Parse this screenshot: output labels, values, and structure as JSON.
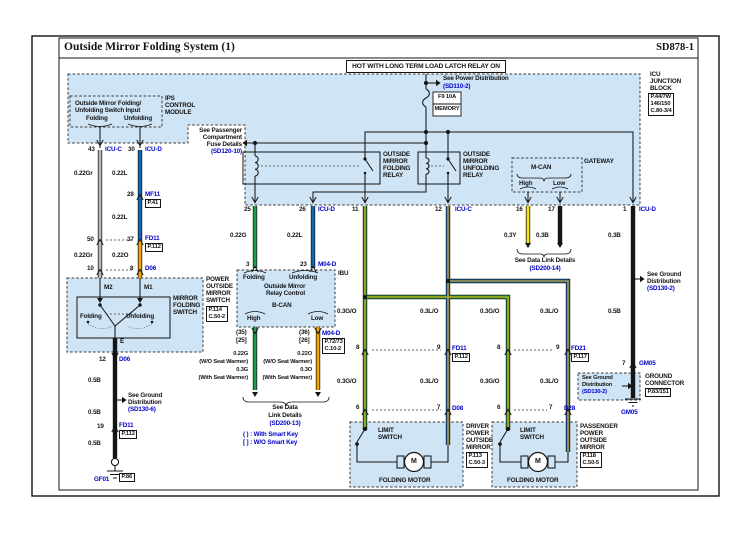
{
  "header": {
    "title": "Outside Mirror Folding System (1)",
    "code": "SD878-1"
  },
  "banner": "HOT WITH LONG TERM LOAD LATCH RELAY ON",
  "top": {
    "see_power": "See Power Distribution",
    "see_power_ref": "(SD110-2)",
    "fuse_name": "F9 10A",
    "fuse_use": "MEMORY",
    "pass1": "See Passenger",
    "pass2": "Compartment",
    "pass3": "Fuse Details",
    "pass_ref": "(SD120-10)"
  },
  "icu": {
    "n1": "ICU",
    "n2": "JUNCTION",
    "n3": "BLOCK",
    "r1": "P.44/7W",
    "r2": "146/150",
    "r3": "C.80-3/4"
  },
  "ips": {
    "n1": "IPS",
    "n2": "CONTROL",
    "n3": "MODULE",
    "t1": "Outside Mirror Folding/",
    "t2": "Unfolding Switch Input",
    "fold": "Folding",
    "unfold": "Unfolding"
  },
  "relays": {
    "f1": "OUTSIDE",
    "f2": "MIRROR",
    "f3": "FOLDING",
    "f4": "RELAY",
    "u3": "UNFOLDING"
  },
  "gateway": {
    "name": "GATEWAY",
    "bus": "M-CAN",
    "high": "High",
    "low": "Low"
  },
  "pins": {
    "p43": "43",
    "p30": "30",
    "p28": "28",
    "p50": "50",
    "p37": "37",
    "p10": "10",
    "p8": "8",
    "p12": "12",
    "p19": "19",
    "p25": "25",
    "p26": "26",
    "p11": "11",
    "p16": "16",
    "p17": "17",
    "p1": "1",
    "p3": "3",
    "p23": "23",
    "p9": "9",
    "p6": "6",
    "p7": "7"
  },
  "conn": {
    "icu_c": "ICU-C",
    "icu_d": "ICU-D",
    "mf11": "MF11",
    "fd11": "FD11",
    "fd21": "FD21",
    "d06": "D06",
    "d08": "D08",
    "d28": "D28",
    "m04": "M04-D",
    "gm05": "GM05",
    "gf01": "GF01",
    "m2": "M2",
    "m1": "M1",
    "e": "E"
  },
  "refs": {
    "p41": "P.41",
    "p112": "P.112",
    "p117": "P.117",
    "p114": "P.114",
    "c502": "C.50-2",
    "p113": "P.113",
    "c503": "C.50-3",
    "p118": "P.118",
    "c505": "C.50-5",
    "p7273": "P.72/73",
    "c102": "C.10-2",
    "p83": "P.83/151",
    "p86": "P.86"
  },
  "wires": {
    "gr022": "0.22Gr",
    "l022": "0.22L",
    "o022": "0.22O",
    "g022": "0.22G",
    "go03": "0.3G/O",
    "lo03": "0.3L/O",
    "y03": "0.3Y",
    "b03": "0.3B",
    "b05": "0.5B"
  },
  "sw": {
    "n1": "MIRROR",
    "n2": "FOLDING",
    "n3": "SWITCH",
    "fold": "Folding",
    "unfold": "Unfolding",
    "o1": "POWER",
    "o2": "OUTSIDE",
    "o3": "MIRROR",
    "o4": "SWITCH"
  },
  "ibu": {
    "name": "IBU",
    "fold": "Folding",
    "unfold": "Unfolding",
    "c1": "Outside Mirror",
    "c2": "Relay Control",
    "bcan": "B-CAN",
    "high": "High",
    "low": "Low",
    "c35": "(35)",
    "b25": "[25]",
    "c36": "(36)",
    "b26": "[26]",
    "wg1": "0.22G",
    "wg2": "0.3G",
    "wo1": "0.22O",
    "wo2": "0.3O",
    "wo_sw": "(W/O Seat Warmer)",
    "w_sw": "(With Seat Warmer)",
    "dl1": "See Data",
    "dl2": "Link Details",
    "dl_ref": "(SD200-13)",
    "key1": "( ) : With Smart Key",
    "key2": "[ ] : W/O Smart Key"
  },
  "notes": {
    "dlr1": "See Data Link Details",
    "dlr_ref": "(SD200-14)",
    "gnd1": "See Ground",
    "gnd2": "Distribution",
    "gnd6_ref": "(SD130-6)",
    "gnd2_ref": "(SD130-2)",
    "gc1": "GROUND",
    "gc2": "CONNECTOR"
  },
  "motors": {
    "ls1": "LIMIT",
    "ls2": "SWITCH",
    "fm": "FOLDING MOTOR",
    "m": "M",
    "d1": "DRIVER",
    "d2": "POWER",
    "d3": "OUTSIDE",
    "d4": "MIRROR",
    "pa1": "PASSENGER"
  },
  "colors": {
    "region": "#cfe4f5",
    "green": "#1f9e48",
    "blue": "#1467b8",
    "orange": "#f7a600",
    "yellow": "#f0e20c",
    "gray": "#b9b9bf",
    "black": "#151515",
    "ref_blue": "#0000c8"
  }
}
